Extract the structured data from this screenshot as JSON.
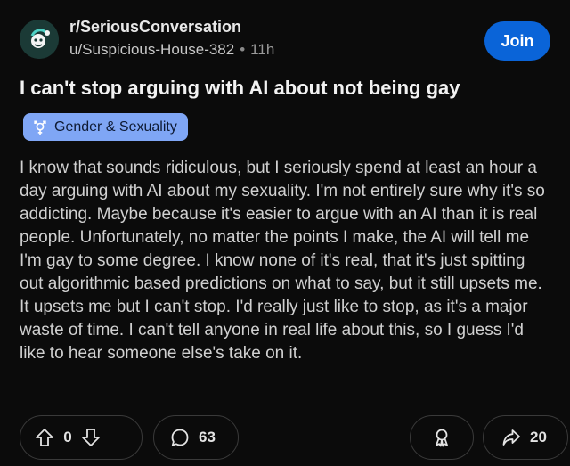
{
  "post": {
    "subreddit": "r/SeriousConversation",
    "author": "u/Suspicious-House-382",
    "separator": "•",
    "age": "11h",
    "join_label": "Join",
    "title": "I can't stop arguing with AI about not being gay",
    "flair": "Gender & Sexuality",
    "body": "I know that sounds ridiculous, but I seriously spend at least an hour a day arguing with AI about my sexuality. I'm not entirely sure why it's so addicting. Maybe because it's easier to argue with an AI than it is real people. Unfortunately, no matter the points I make, the AI will tell me I'm gay to some degree. I know none of it's real, that it's just spitting out algorithmic based predictions on what to say, but it still upsets me. It upsets me but I can't stop. I'd really just like to stop, as it's a major waste of time. I can't tell anyone in real life about this, so I guess I'd like to hear someone else's take on it."
  },
  "actions": {
    "vote_count": "0",
    "comment_count": "63",
    "share_count": "20"
  },
  "icons": {
    "avatar": "subreddit-avatar-icon",
    "flair": "gender-symbol-icon",
    "upvote": "upvote-arrow-icon",
    "downvote": "downvote-arrow-icon",
    "comment": "comment-bubble-icon",
    "award": "award-ribbon-icon",
    "share": "share-arrow-icon"
  },
  "colors": {
    "background": "#0b0b0b",
    "join_button": "#0a64d8",
    "flair_background": "#7fa6f5",
    "pill_border": "#3a3a3a"
  }
}
